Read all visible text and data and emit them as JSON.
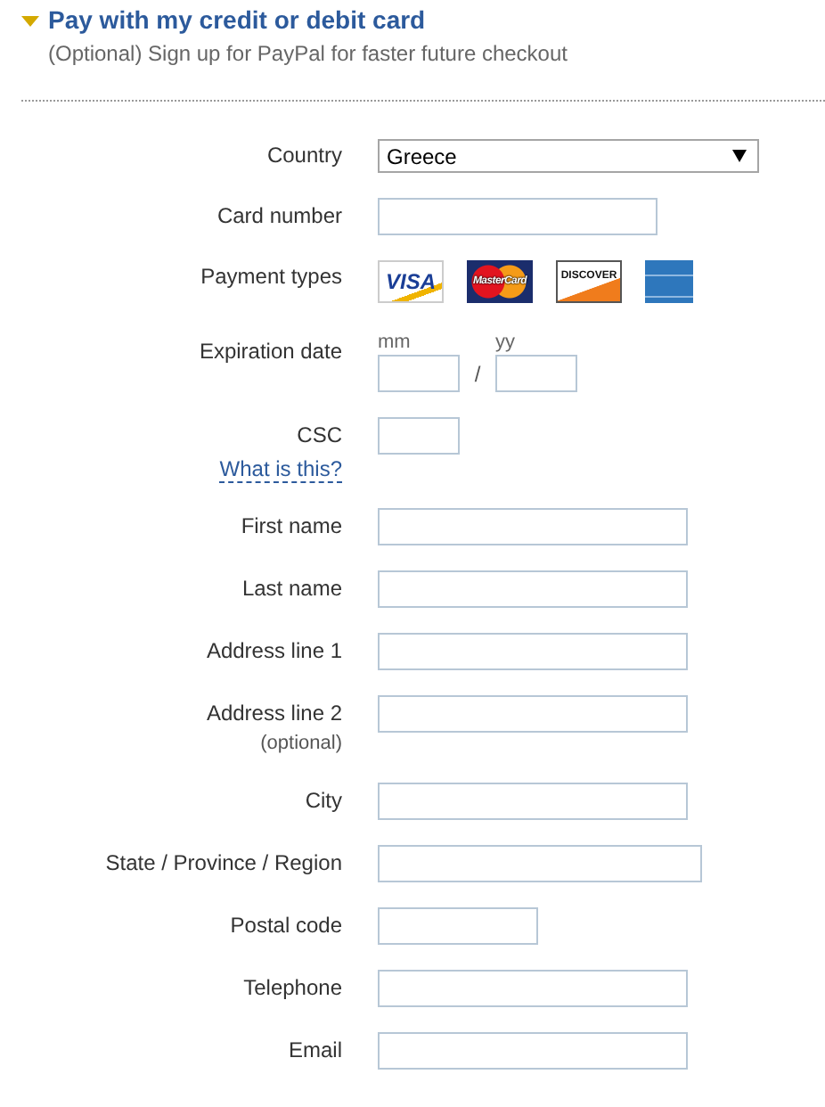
{
  "header": {
    "title": "Pay with my credit or debit card",
    "expanded": true,
    "subtitle": "(Optional) Sign up for PayPal for faster future checkout"
  },
  "rows": [
    {
      "kind": "select",
      "label": "Country",
      "value": "Greece"
    },
    {
      "kind": "card-number",
      "label": "Card number"
    },
    {
      "kind": "card-logos",
      "label": "Payment types",
      "cards": [
        {
          "kind": "visa",
          "text": "VISA"
        },
        {
          "kind": "mastercard",
          "text": "MasterCard"
        },
        {
          "kind": "discover",
          "text": "DISCOVER"
        },
        {
          "kind": "amex"
        }
      ]
    },
    {
      "kind": "expiry",
      "label": "Expiration date",
      "month_label": "mm",
      "separator": "/",
      "year_label": "yy"
    },
    {
      "kind": "csc",
      "label": "CSC",
      "help_link": "What is this?"
    },
    {
      "kind": "text",
      "label": "First name"
    },
    {
      "kind": "text",
      "label": "Last name"
    },
    {
      "kind": "text",
      "label": "Address line 1"
    },
    {
      "kind": "text",
      "label": "Address line 2",
      "note": "(optional)"
    },
    {
      "kind": "text",
      "label": "City"
    },
    {
      "kind": "region",
      "label": "State / Province / Region"
    },
    {
      "kind": "postal",
      "label": "Postal code"
    },
    {
      "kind": "text",
      "label": "Telephone"
    },
    {
      "kind": "text",
      "label": "Email"
    }
  ]
}
